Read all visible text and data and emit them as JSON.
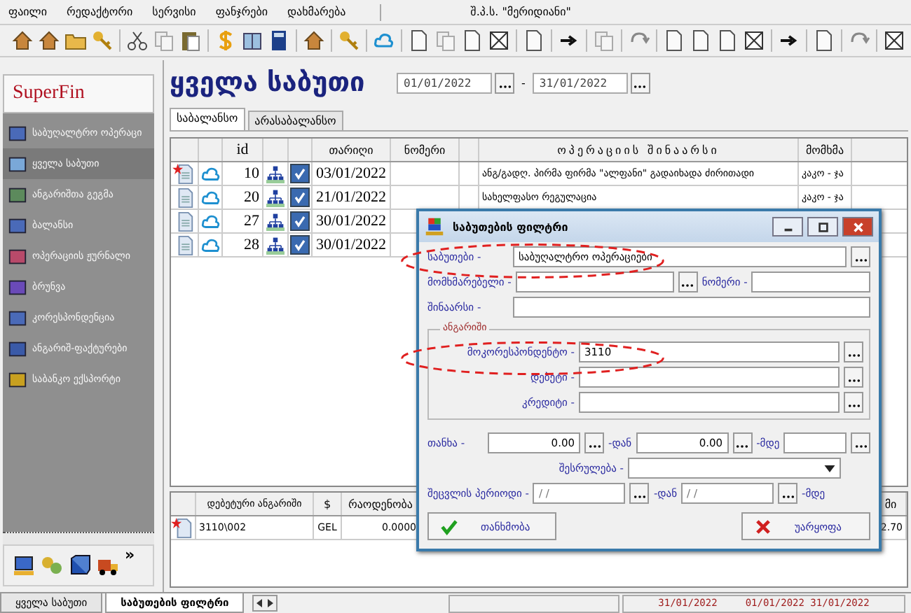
{
  "menu": [
    {
      "label": "ფაილი"
    },
    {
      "label": "რედაქტორი"
    },
    {
      "label": "სერვისი"
    },
    {
      "label": "ფანჯრები"
    },
    {
      "label": "დახმარება"
    }
  ],
  "company": "შ.პ.ს. \"მერიდიანი\"",
  "sidebar": {
    "title": "SuperFin",
    "items": [
      {
        "label": "საბუღალტრო ოპერაცი",
        "selected": false
      },
      {
        "label": "ყველა საბუთი",
        "selected": true
      },
      {
        "label": "ანგარიშთა გეგმა",
        "selected": false
      },
      {
        "label": "ბალანსი",
        "selected": false
      },
      {
        "label": "ოპერაციის ჟურნალი",
        "selected": false
      },
      {
        "label": "ბრუნვა",
        "selected": false
      },
      {
        "label": "კორესპონდენცია",
        "selected": false
      },
      {
        "label": "ანგარიშ-ფაქტურები",
        "selected": false
      },
      {
        "label": "საბანკო ექსპორტი",
        "selected": false
      }
    ],
    "more": "»"
  },
  "page": {
    "title": "ყველა საბუთი",
    "date_from": "01/01/2022",
    "date_sep": "-",
    "date_to": "31/01/2022"
  },
  "tabs": [
    {
      "label": "საბალანსო",
      "selected": true
    },
    {
      "label": "არასაბალანსო",
      "selected": false
    }
  ],
  "table": {
    "columns": [
      "id",
      "თარიღი",
      "ნომერი",
      "ოპერაციის შინაარსი",
      "მომხმა"
    ],
    "rows": [
      {
        "flagged": true,
        "id": "10",
        "checked": true,
        "date": "03/01/2022",
        "content": "ანგ/გადღ. პირმა ფირმა \"ალფანი\" გადაიხადა ძირითადი",
        "user": "კაკო - ჯა"
      },
      {
        "flagged": false,
        "id": "20",
        "checked": true,
        "date": "21/01/2022",
        "content": "სახელფასო რეგულაცია",
        "user": "კაკო - ჯა"
      },
      {
        "flagged": false,
        "id": "27",
        "checked": true,
        "date": "30/01/2022"
      },
      {
        "flagged": false,
        "id": "28",
        "checked": true,
        "date": "30/01/2022"
      }
    ]
  },
  "lines_table": {
    "columns": [
      "დებეტური ანგარიში",
      "$",
      "რაოდენობა",
      "მი"
    ],
    "rows": [
      {
        "flagged": true,
        "account": "3110\\002",
        "currency": "GEL",
        "quantity": "0.0000",
        "last": "2.70"
      }
    ]
  },
  "filter_dialog": {
    "title": "საბუთების ფილტრი",
    "documents_label": "საბუთები -",
    "documents_value": "საბუღალტრო ოპერაციები",
    "customer_label": "მომხმარებელი -",
    "number_label": "ნომერი -",
    "content_label": "შინაარსი -",
    "group_title": "ანგარიში",
    "corr_label": "მოკორესპონდენტო -",
    "corr_value": "3110",
    "debit_label": "დებეტი -",
    "credit_label": "კრედიტი -",
    "amount_label": "თანხა -",
    "amount_from": "0.00",
    "amount_from_label": "-დან",
    "amount_to": "0.00",
    "amount_to_label": "-მდე",
    "status_label": "შესრულება -",
    "period_label": "შეცვლის პერიოდი -",
    "period_from": " /  /",
    "period_from_label": "-დან",
    "period_to": " /  /",
    "period_to_label": "-მდე",
    "ok": "თანხმობა",
    "cancel": "უარყოფა"
  },
  "bottom_tabs": [
    {
      "label": "ყველა საბუთი",
      "selected": false
    },
    {
      "label": "საბუთების ფილტრი",
      "selected": true
    }
  ],
  "status_bar": {
    "date": "31/01/2022",
    "range": "01/01/2022 31/01/2022"
  }
}
